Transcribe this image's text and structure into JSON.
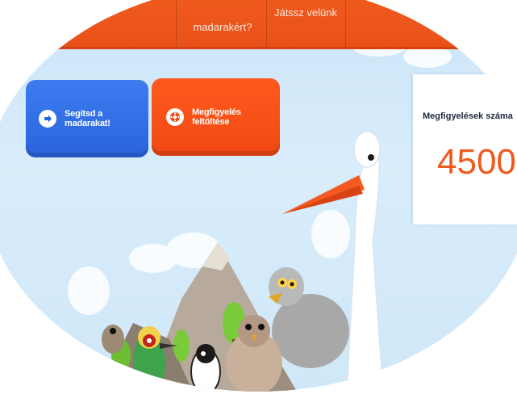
{
  "nav": {
    "items": [
      {
        "line1": "",
        "line2": "madarakért?"
      },
      {
        "line1": "Játssz velünk",
        "line2": ""
      }
    ]
  },
  "actions": {
    "help_birds": "Segítsd a madarakat!",
    "upload_observation": "Megfigyelés feltöltése"
  },
  "counter": {
    "label": "Megfigyelések száma",
    "value": "4500"
  },
  "colors": {
    "nav_orange": "#e9511a",
    "button_blue": "#2f6fe6",
    "button_orange": "#ff541a",
    "counter_orange": "#f05a1e"
  }
}
